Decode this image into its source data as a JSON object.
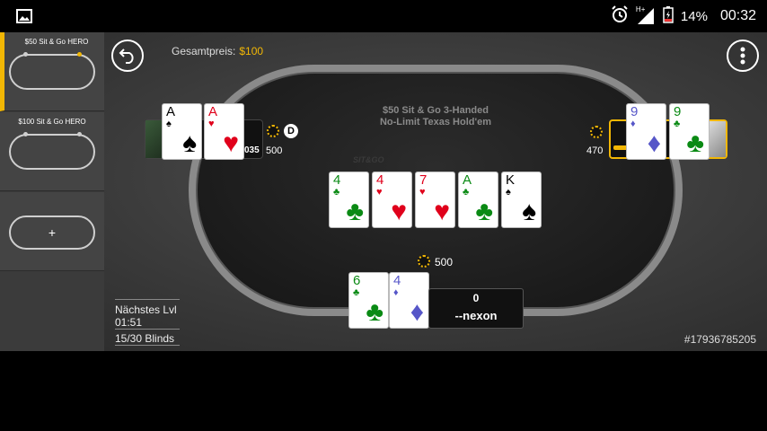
{
  "statusbar": {
    "gallery_icon": "image-icon",
    "alarm_icon": "alarm-icon",
    "network_label": "H+",
    "battery_percent": "14%",
    "time": "00:32"
  },
  "sidebar": {
    "tables": [
      {
        "title": "$50 Sit & Go HERO",
        "active": true
      },
      {
        "title": "$100 Sit & Go HERO",
        "active": false
      }
    ],
    "add_label": "+"
  },
  "header": {
    "prize_label": "Gesamtpreis:",
    "prize_value": "$100",
    "back_icon": "back-arrow-icon",
    "menu_icon": "more-vertical-icon"
  },
  "table": {
    "game_line1": "$50 Sit & Go 3-Handed",
    "game_line2": "No-Limit Texas Hold'em",
    "watermark": "SIT&GO",
    "board": [
      {
        "rank": "4",
        "suit": "♣",
        "color": "green"
      },
      {
        "rank": "4",
        "suit": "♥",
        "color": "red"
      },
      {
        "rank": "7",
        "suit": "♥",
        "color": "red"
      },
      {
        "rank": "A",
        "suit": "♣",
        "color": "green"
      },
      {
        "rank": "K",
        "suit": "♠",
        "color": "black"
      }
    ],
    "pot": "500"
  },
  "players": {
    "left": {
      "cards": [
        {
          "rank": "A",
          "suit": "♠",
          "color": "black"
        },
        {
          "rank": "A",
          "suit": "♥",
          "color": "red"
        }
      ],
      "stack_partial": "035",
      "bet": "500",
      "dealer": "D"
    },
    "right": {
      "cards": [
        {
          "rank": "9",
          "suit": "♦",
          "color": "blue"
        },
        {
          "rank": "9",
          "suit": "♣",
          "color": "green"
        }
      ],
      "bet": "470"
    },
    "hero": {
      "cards": [
        {
          "rank": "6",
          "suit": "♣",
          "color": "green"
        },
        {
          "rank": "4",
          "suit": "♦",
          "color": "blue"
        }
      ],
      "amount": "0",
      "name": "--nexon"
    }
  },
  "info": {
    "next_level_label": "Nächstes Lvl",
    "next_level_time": "01:51",
    "blinds": "15/30 Blinds"
  },
  "hand_id": "#17936785205"
}
